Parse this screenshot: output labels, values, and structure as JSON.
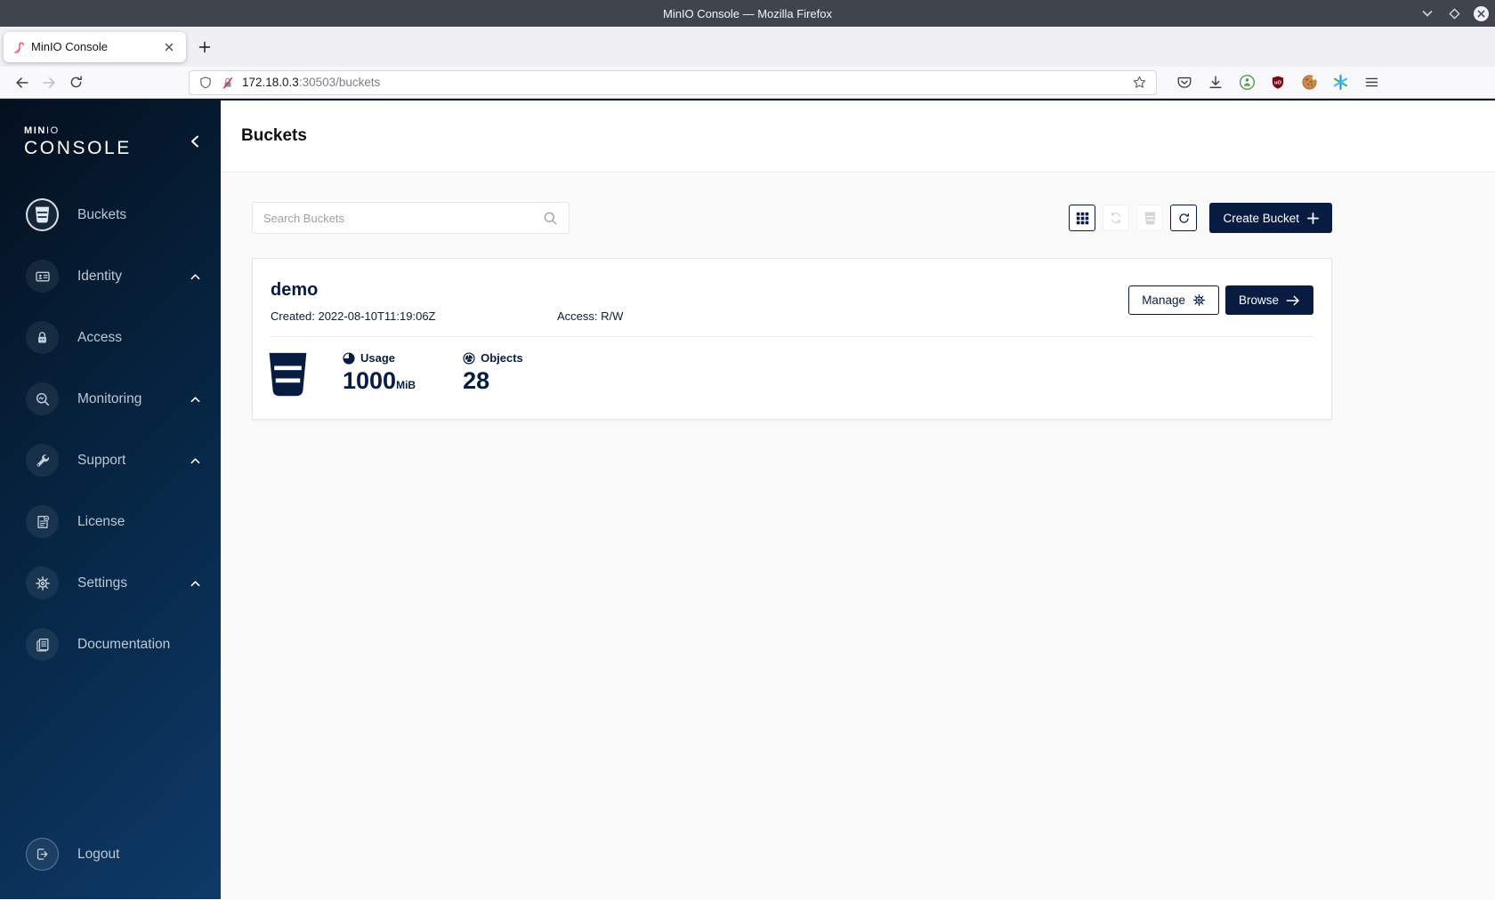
{
  "titlebar": {
    "title": "MinIO Console — Mozilla Firefox"
  },
  "browser": {
    "tab_title": "MinIO Console",
    "url_host": "172.18.0.3",
    "url_rest": ":30503/buckets",
    "ublock_label": "uO"
  },
  "sidebar": {
    "logo_bold": "MIN",
    "logo_light": "IO",
    "logo_main": "CONSOLE",
    "items": [
      {
        "label": "Buckets",
        "icon": "bucket-icon",
        "selected": true
      },
      {
        "label": "Identity",
        "icon": "id-card-icon",
        "expandable": true
      },
      {
        "label": "Access",
        "icon": "lock-icon"
      },
      {
        "label": "Monitoring",
        "icon": "monitor-search-icon",
        "expandable": true
      },
      {
        "label": "Support",
        "icon": "support-wrench-icon",
        "expandable": true
      },
      {
        "label": "License",
        "icon": "license-icon"
      },
      {
        "label": "Settings",
        "icon": "gear-icon",
        "expandable": true
      },
      {
        "label": "Documentation",
        "icon": "documentation-icon"
      }
    ],
    "logout_label": "Logout"
  },
  "page": {
    "title": "Buckets"
  },
  "toolbar": {
    "search_placeholder": "Search Buckets",
    "create_label": "Create Bucket"
  },
  "bucket": {
    "name": "demo",
    "created": "Created: 2022-08-10T11:19:06Z",
    "access": "Access: R/W",
    "manage_label": "Manage",
    "browse_label": "Browse",
    "usage_label": "Usage",
    "usage_value": "1000",
    "usage_unit": "MiB",
    "objects_label": "Objects",
    "objects_value": "28"
  },
  "colors": {
    "accent_navy": "#081C42",
    "sidebar_gradient_start": "#04101e",
    "sidebar_gradient_end": "#0e3a68",
    "titlebar_bg": "#3f444d",
    "content_bg": "#fafafa"
  }
}
